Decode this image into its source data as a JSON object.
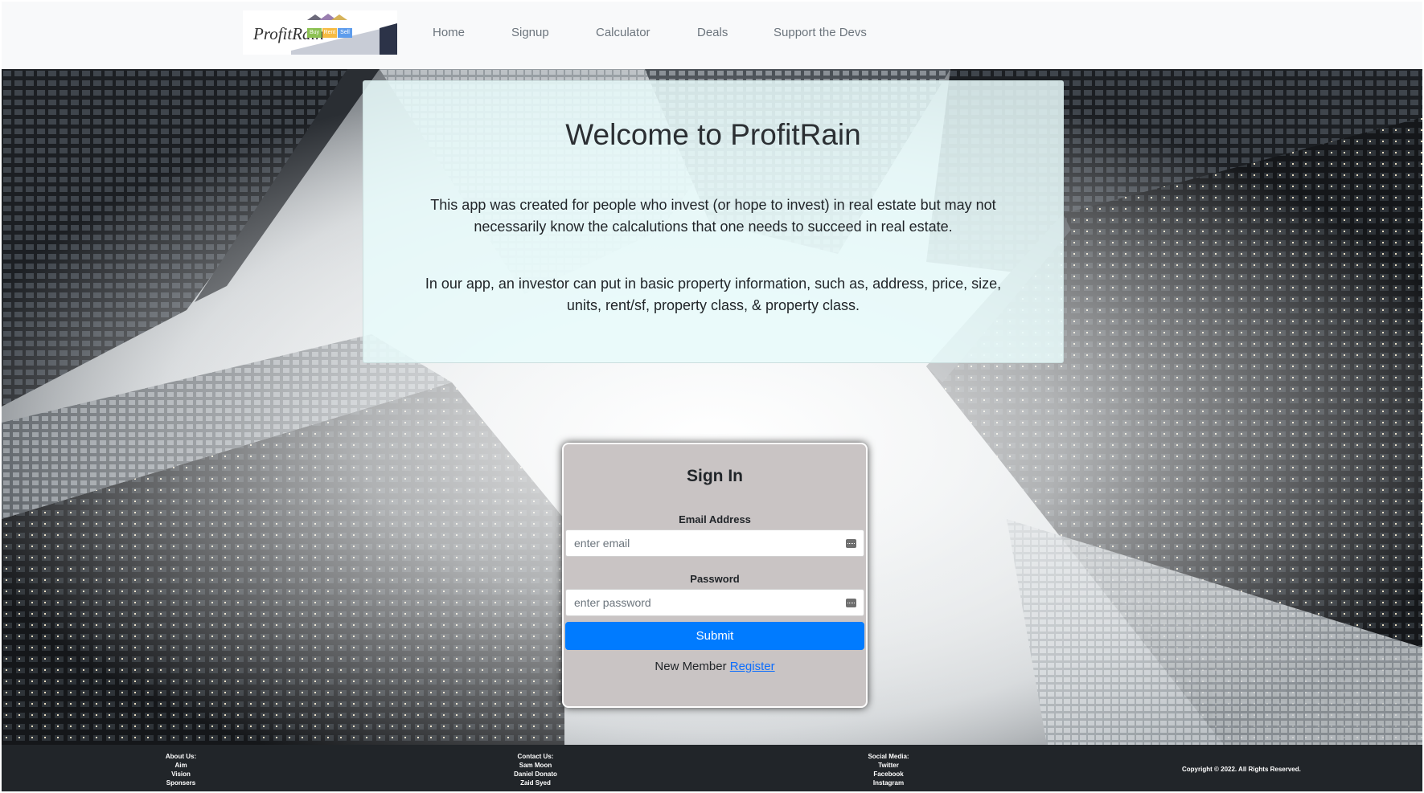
{
  "nav": {
    "logo": {
      "text": "ProfitRain",
      "chips": [
        "Buy",
        "Rent",
        "Sell"
      ]
    },
    "links": [
      "Home",
      "Signup",
      "Calculator",
      "Deals",
      "Support the Devs"
    ]
  },
  "welcome": {
    "title": "Welcome to ProfitRain",
    "paragraph1": "This app was created for people who invest (or hope to invest) in real estate but may not necessarily know the calcalutions that one needs to succeed in real estate.",
    "paragraph2": "In our app, an investor can put in basic property information, such as, address, price, size, units, rent/sf, property class, & property class."
  },
  "signin": {
    "title": "Sign In",
    "email_label": "Email Address",
    "email_placeholder": "enter email",
    "password_label": "Password",
    "password_placeholder": "enter password",
    "submit_label": "Submit",
    "new_member_text": "New Member",
    "register_link": "Register"
  },
  "footer": {
    "about": {
      "title": "About Us:",
      "items": [
        "Aim",
        "Vision",
        "Sponsers"
      ]
    },
    "contact": {
      "title": "Contact Us:",
      "items": [
        "Sam Moon",
        "Daniel Donato",
        "Zaid Syed"
      ]
    },
    "social": {
      "title": "Social Media:",
      "items": [
        "Twitter",
        "Facebook",
        "Instagram"
      ]
    },
    "copyright": "Copyright © 2022. All Rights Reserved."
  },
  "colors": {
    "navbar_bg": "#f8f9fa",
    "accent": "#007bff",
    "link": "#0d6efd",
    "footer_bg": "#212529",
    "signin_bg": "#c9c4c4",
    "welcome_bg": "#e8fafa"
  }
}
